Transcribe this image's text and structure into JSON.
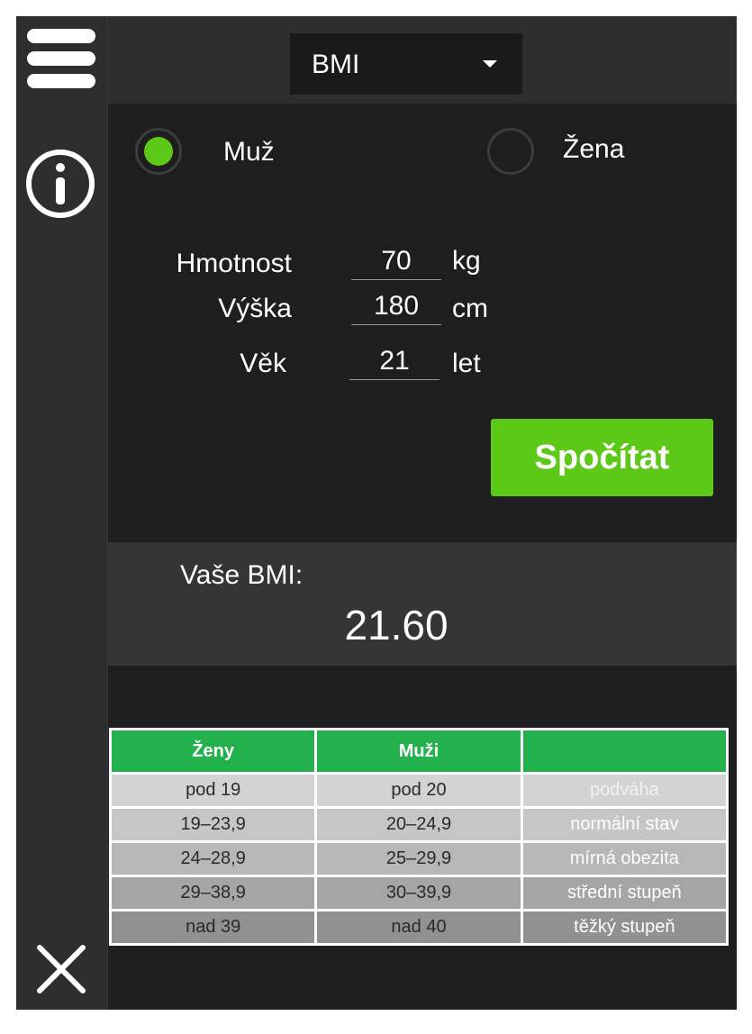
{
  "sidebar": {
    "menu_icon": "hamburger-menu-icon",
    "info_icon": "info-icon",
    "close_icon": "close-icon"
  },
  "header": {
    "mode_selected": "BMI"
  },
  "gender": {
    "male_label": "Muž",
    "female_label": "Žena",
    "selected": "Muž"
  },
  "form": {
    "weight": {
      "label": "Hmotnost",
      "value": "70",
      "unit": "kg"
    },
    "height": {
      "label": "Výška",
      "value": "180",
      "unit": "cm"
    },
    "age": {
      "label": "Věk",
      "value": "21",
      "unit": "let"
    },
    "calculate_label": "Spočítat"
  },
  "result": {
    "label": "Vaše BMI:",
    "value": "21.60"
  },
  "bmi_table": {
    "headers": [
      "Ženy",
      "Muži",
      ""
    ],
    "rows": [
      [
        "pod 19",
        "pod 20",
        "podváha"
      ],
      [
        "19–23,9",
        "20–24,9",
        "normální stav"
      ],
      [
        "24–28,9",
        "25–29,9",
        "mírná obezita"
      ],
      [
        "29–38,9",
        "30–39,9",
        "střední stupeň"
      ],
      [
        "nad 39",
        "nad 40",
        "těžký stupeň"
      ]
    ]
  },
  "colors": {
    "accent_green": "#5cc817",
    "table_header_green": "#22b14c",
    "background": "#1e1e1e",
    "panel": "#2e2e2e"
  }
}
